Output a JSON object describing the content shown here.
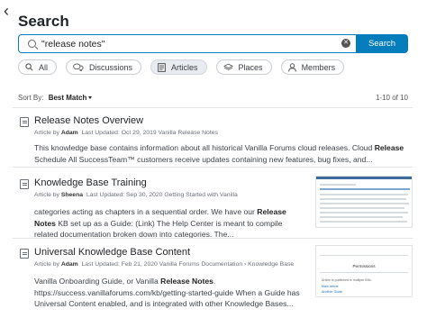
{
  "header": {
    "title": "Search",
    "back_icon": "chevron-left-icon"
  },
  "search": {
    "value": "\"release notes\"",
    "button_label": "Search"
  },
  "filters": [
    {
      "label": "All",
      "icon": "search-icon",
      "active": false
    },
    {
      "label": "Discussions",
      "icon": "discussions-icon",
      "active": false
    },
    {
      "label": "Articles",
      "icon": "article-icon",
      "active": true
    },
    {
      "label": "Places",
      "icon": "places-icon",
      "active": false
    },
    {
      "label": "Members",
      "icon": "member-icon",
      "active": false
    }
  ],
  "sort": {
    "label": "Sort By:",
    "value": "Best Match",
    "count": "1-10 of 10"
  },
  "results": [
    {
      "title": "Release Notes Overview",
      "meta_prefix": "Article by",
      "author": "Adam",
      "meta_rest": "Last Updated: Oct 29, 2019   Vanilla Release Notes",
      "excerpt_parts": [
        {
          "text": "This knowledge base contains information about all historical Vanilla Forums cloud releases. Cloud ",
          "bold": false
        },
        {
          "text": "Release",
          "bold": true
        },
        {
          "text": " Schedule All SuccessTeam™ customers receive updates containing new features, bug fixes, and...",
          "bold": false
        }
      ]
    },
    {
      "title": "Knowledge Base Training",
      "meta_prefix": "Article by",
      "author": "Sheena",
      "meta_rest": "Last Updated: Sep 30, 2020   Getting Started with Vanilla",
      "excerpt_parts": [
        {
          "text": "categories acting as chapters in a sequential order.  We have our ",
          "bold": false
        },
        {
          "text": "Release Notes",
          "bold": true
        },
        {
          "text": " KB set up as a Guide: (Link) The Help Center is meant to compile related documentation broken down into categories.  The...",
          "bold": false
        }
      ]
    },
    {
      "title": "Universal Knowledge Base Content",
      "meta_prefix": "Article by",
      "author": "Adam",
      "meta_rest": "Last Updated: Feb 21, 2020   Vanilla Forums Documentation › Knowledge Base",
      "excerpt_parts": [
        {
          "text": "Vanilla Onboarding Guide, or Vanilla ",
          "bold": false
        },
        {
          "text": "Release Notes",
          "bold": true
        },
        {
          "text": ". https://success.vanillaforums.com/kb/getting-started-guide When a Guide has Universal Content enabled, and is integrated with other Knowledge Bases...",
          "bold": false
        }
      ],
      "thumb": {
        "label": "Permissions",
        "line1": "Article is published in multiple KBs.",
        "line2": "Main Article",
        "line3": "Another Guide"
      }
    }
  ],
  "colors": {
    "accent": "#037dbc"
  }
}
